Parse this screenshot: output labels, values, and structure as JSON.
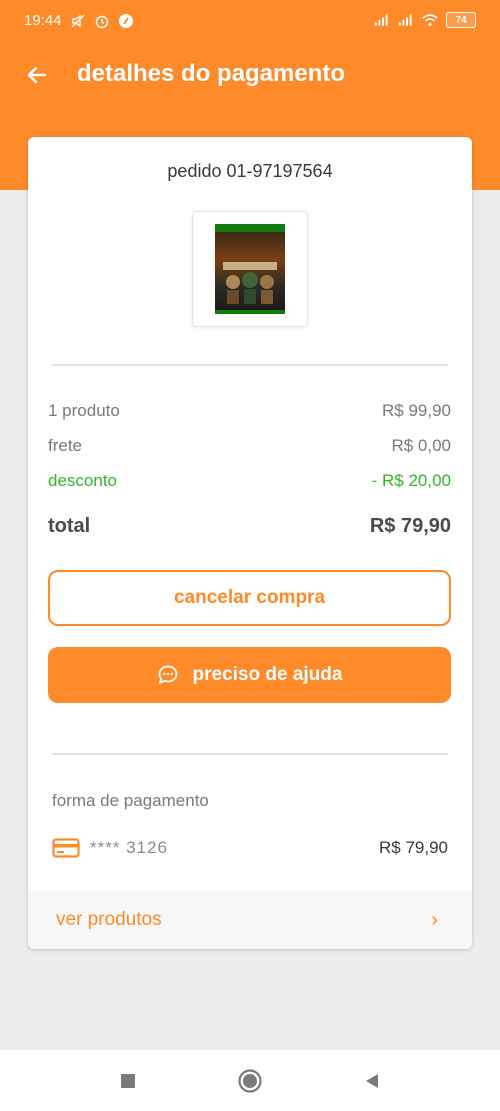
{
  "status_bar": {
    "time": "19:44",
    "battery": "74",
    "icons": [
      "mute-icon",
      "alarm-icon",
      "notification-icon",
      "signal-icon",
      "signal-icon",
      "wifi-icon",
      "battery-icon"
    ]
  },
  "header": {
    "title": "detalhes do pagamento",
    "back_icon": "arrow-left-icon"
  },
  "order": {
    "id": "pedido 01-97197564",
    "product_image": "game-cover-thumbnail"
  },
  "summary": {
    "products_label": "1 produto",
    "products_value": "R$ 99,90",
    "shipping_label": "frete",
    "shipping_value": "R$ 0,00",
    "discount_label": "desconto",
    "discount_value": "- R$ 20,00",
    "total_label": "total",
    "total_value": "R$ 79,90"
  },
  "actions": {
    "cancel_label": "cancelar compra",
    "help_label": "preciso de ajuda"
  },
  "payment": {
    "label": "forma de pagamento",
    "card_masked": "**** 3126",
    "amount": "R$ 79,90"
  },
  "footer": {
    "link_label": "ver produtos",
    "chevron": "›"
  },
  "colors": {
    "accent": "#ff8a2a",
    "discount": "#35b52f",
    "background": "#ececec"
  }
}
